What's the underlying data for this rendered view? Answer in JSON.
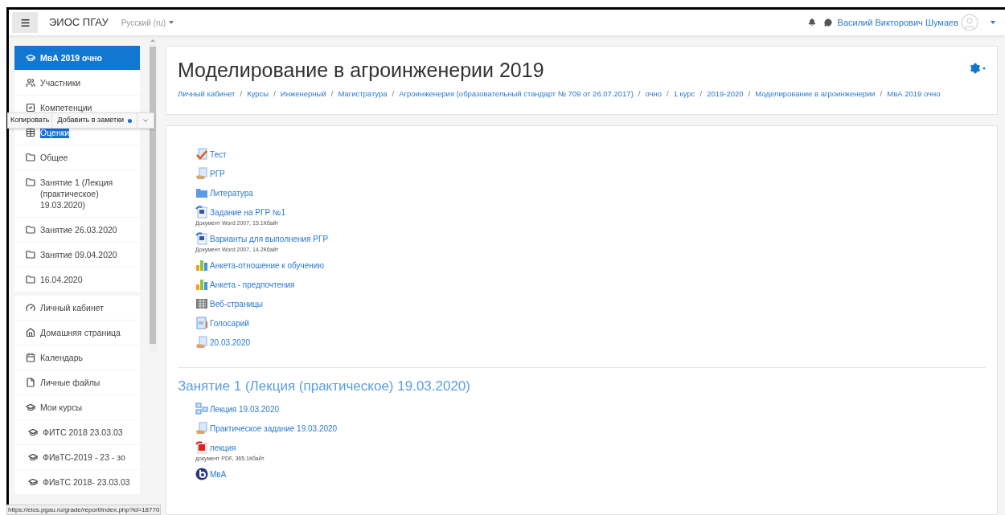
{
  "navbar": {
    "site_name": "ЭИОС ПГАУ",
    "language": "Русский ‎(ru)‎",
    "user_name": "Василий Викторович Шумаев"
  },
  "sidebar": {
    "items": [
      {
        "label": "МвА 2019 очно",
        "kind": "cap",
        "selected": true,
        "highlighted": false
      },
      {
        "label": "Участники",
        "kind": "users",
        "selected": false,
        "highlighted": false
      },
      {
        "label": "Компетенции",
        "kind": "check",
        "selected": false,
        "highlighted": false
      },
      {
        "label": "Оценки",
        "kind": "table",
        "selected": false,
        "highlighted": true
      },
      {
        "label": "Общее",
        "kind": "folder",
        "selected": false,
        "highlighted": false
      },
      {
        "label": "Занятие 1 (Лекция (практическое) 19.03.2020)",
        "kind": "folder",
        "selected": false,
        "highlighted": false
      },
      {
        "label": "Занятие 26.03.2020",
        "kind": "folder",
        "selected": false,
        "highlighted": false
      },
      {
        "label": "Занятие 09.04.2020",
        "kind": "folder",
        "selected": false,
        "highlighted": false
      },
      {
        "label": "16.04.2020",
        "kind": "folder",
        "selected": false,
        "highlighted": false
      }
    ],
    "nav_items": [
      {
        "label": "Личный кабинет",
        "kind": "dashboard"
      },
      {
        "label": "Домашняя страница",
        "kind": "home"
      },
      {
        "label": "Календарь",
        "kind": "calendar"
      },
      {
        "label": "Личные файлы",
        "kind": "file"
      },
      {
        "label": "Мои курсы",
        "kind": "cap"
      },
      {
        "label": "ФИТС 2018 23.03.03",
        "kind": "course"
      },
      {
        "label": "ФИвТС-2019 - 23 - зо",
        "kind": "course"
      },
      {
        "label": "ФИвТС 2018- 23.03.03",
        "kind": "course"
      }
    ]
  },
  "popup": {
    "buttons": [
      "Копировать",
      "Добавить в заметки"
    ]
  },
  "header": {
    "title": "Моделирование в агроинженерии 2019",
    "separator": "/",
    "breadcrumbs": [
      "Личный кабинет",
      "Курсы",
      "Инженерный",
      "Магистратура",
      "Агроинженерия (образовательный стандарт № 709 от 26.07.2017)",
      "очно",
      "1 курс",
      "2019-2020",
      "Моделирование в агроинженерии",
      "МвА 2019 очно"
    ]
  },
  "sections": [
    {
      "activities": [
        {
          "name": "Тест",
          "kind": "quiz"
        },
        {
          "name": "РГР",
          "kind": "assign"
        },
        {
          "name": "Литература",
          "kind": "folder"
        },
        {
          "name": "Задание на РГР №1",
          "kind": "word",
          "meta": "Документ Word 2007, 15.1Кбайт"
        },
        {
          "name": "Варианты для выполнения РГР",
          "kind": "word",
          "meta": "Документ Word 2007, 14.2Кбайт"
        },
        {
          "name": "Анкета-отношение к обучению",
          "kind": "feedback"
        },
        {
          "name": "Анкета - предпочтения",
          "kind": "feedback"
        },
        {
          "name": "Веб-страницы",
          "kind": "package"
        },
        {
          "name": "Голосарий",
          "kind": "glossary"
        },
        {
          "name": "20.03.2020",
          "kind": "assign"
        }
      ]
    },
    {
      "title": "Занятие 1 (Лекция (практическое) 19.03.2020)",
      "activities": [
        {
          "name": "Лекция 19.03.2020",
          "kind": "lesson"
        },
        {
          "name": "Практическое задание 19.03.2020",
          "kind": "assign"
        },
        {
          "name": "лекция",
          "kind": "pdf",
          "meta": "документ PDF, 365.1Кбайт"
        },
        {
          "name": "МвА",
          "kind": "bbb"
        }
      ]
    }
  ],
  "status_url": "https://eios.pgau.ru/grade/report/index.php?id=18770"
}
